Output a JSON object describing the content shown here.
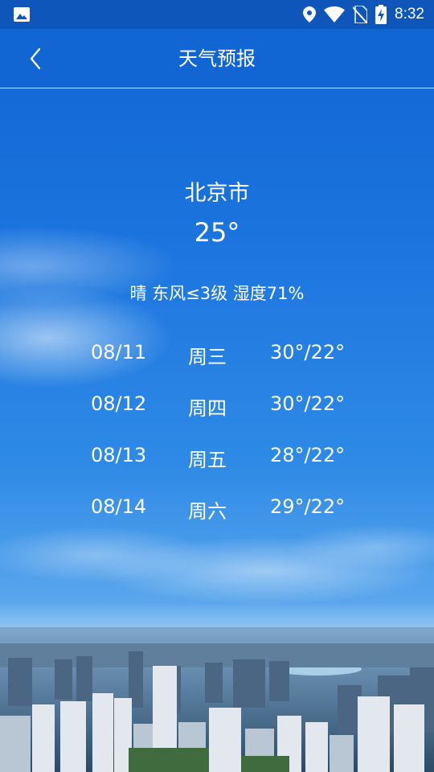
{
  "status_bar": {
    "time": "8:32",
    "icons": [
      "image-icon",
      "location-icon",
      "wifi-icon",
      "no-sim-icon",
      "battery-charging-icon"
    ]
  },
  "header": {
    "title": "天气预报",
    "back_icon": "chevron-left-icon"
  },
  "weather": {
    "city": "北京市",
    "current_temp": "25°",
    "condition": "晴 东风≤3级 湿度71%"
  },
  "forecast": [
    {
      "date": "08/11",
      "day": "周三",
      "range": "30°/22°"
    },
    {
      "date": "08/12",
      "day": "周四",
      "range": "30°/22°"
    },
    {
      "date": "08/13",
      "day": "周五",
      "range": "28°/22°"
    },
    {
      "date": "08/14",
      "day": "周六",
      "range": "29°/22°"
    }
  ],
  "colors": {
    "status_bar": "#0e56b9",
    "app_bar": "#1266d4",
    "text": "#ffffff"
  }
}
